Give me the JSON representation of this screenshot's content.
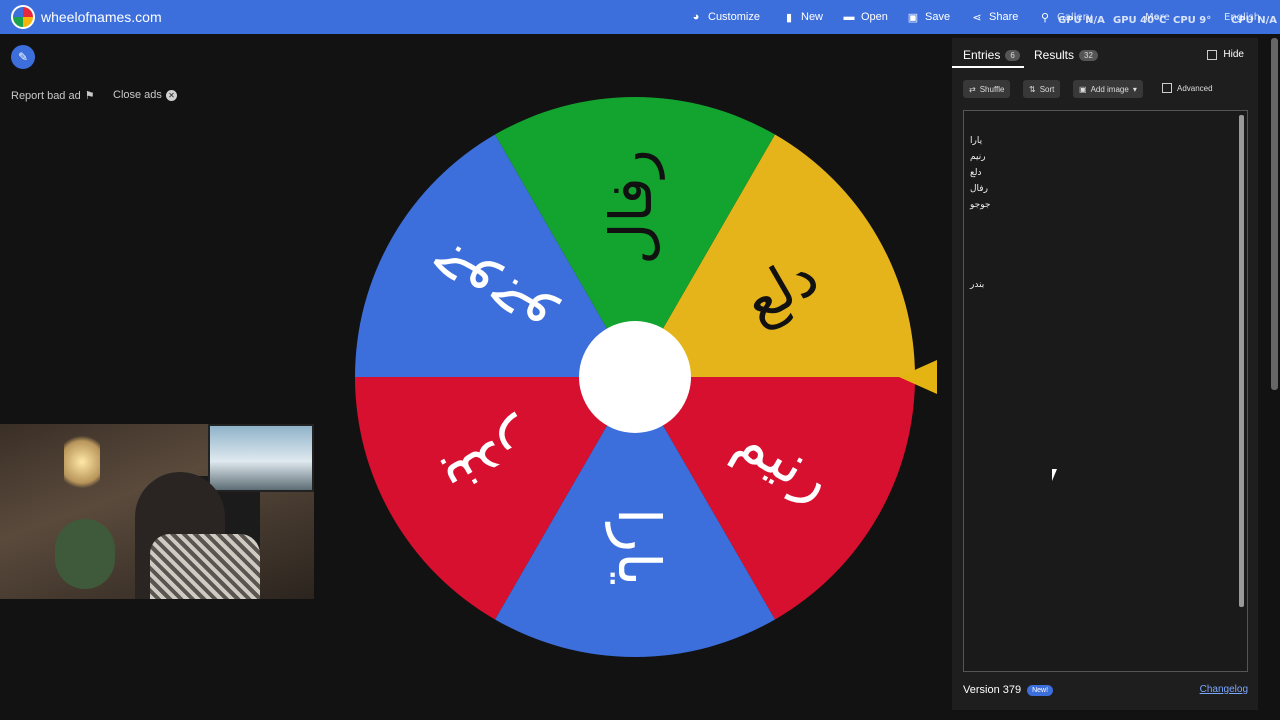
{
  "app": {
    "site_name": "wheelofnames.com"
  },
  "nav": [
    {
      "label": "Customize",
      "icon": "palette-icon",
      "glyph": "◕"
    },
    {
      "label": "New",
      "icon": "file-icon",
      "glyph": "▮"
    },
    {
      "label": "Open",
      "icon": "folder-icon",
      "glyph": "▬"
    },
    {
      "label": "Save",
      "icon": "save-icon",
      "glyph": "▣"
    },
    {
      "label": "Share",
      "icon": "share-icon",
      "glyph": "⋖"
    }
  ],
  "overlay_text": [
    "Gallery",
    "More",
    "English",
    "GPU N/A",
    "GPU 40°C",
    "CPU 9°",
    "CPU N/A"
  ],
  "ads": {
    "report_label": "Report bad ad",
    "close_label": "Close ads"
  },
  "wheel": {
    "segments": [
      {
        "label": "دلع",
        "color": "#e5b41b"
      },
      {
        "label": "رنيم",
        "color": "#d7102f"
      },
      {
        "label": "يارا",
        "color": "#3c6fdc"
      },
      {
        "label": "بندر",
        "color": "#d7102f"
      },
      {
        "label": "جوجو",
        "color": "#3c6fdc"
      },
      {
        "label": "رفال",
        "color": "#13a32f"
      }
    ],
    "text_color_dark": "#111111",
    "text_color_light": "#ffffff"
  },
  "panel": {
    "entries_tab": "Entries",
    "entries_count": "6",
    "results_tab": "Results",
    "results_count": "32",
    "hide_label": "Hide",
    "shuffle_label": "Shuffle",
    "sort_label": "Sort",
    "add_image_label": "Add image",
    "advanced_label": "Advanced",
    "entries": [
      "يارا",
      "رنيم",
      "دلع",
      "رفال",
      "جوجو",
      "بندر"
    ],
    "version_label": "Version 379",
    "new_badge": "New!",
    "changelog_label": "Changelog"
  },
  "colors": {
    "accent": "#3c6fdc",
    "background": "#121212",
    "panel": "#1e1e1e"
  }
}
